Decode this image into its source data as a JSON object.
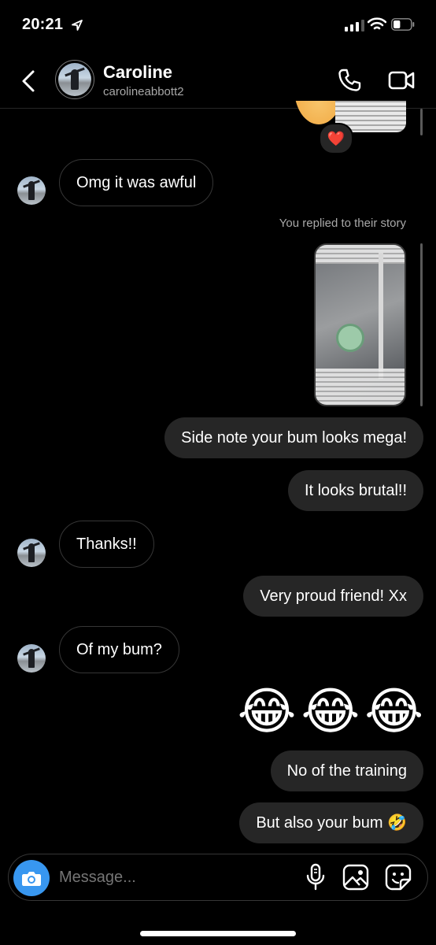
{
  "status_bar": {
    "time": "20:21",
    "battery_level": 0.4
  },
  "header": {
    "name": "Caroline",
    "handle": "carolineabbott2"
  },
  "messages": {
    "reaction_emoji": "❤️",
    "m1": "Omg it was awful",
    "replied_label": "You replied to their story",
    "m2": "Side note your bum looks mega!",
    "m3": "It looks brutal!!",
    "m4": "Thanks!!",
    "m5": "Very proud friend! Xx",
    "m6": "Of my bum?",
    "emoji_row": [
      "😂",
      "😂",
      "😂"
    ],
    "m7": "No of the training",
    "m8": "But also your bum 🤣"
  },
  "composer": {
    "placeholder": "Message..."
  },
  "colors": {
    "accent": "#3897f0",
    "incoming_border": "#363636",
    "outgoing_bg": "#262626",
    "secondary_text": "#a8a8a8"
  },
  "icons": [
    "location-arrow-icon",
    "signal-icon",
    "wifi-icon",
    "battery-icon",
    "back-chevron-icon",
    "phone-icon",
    "video-camera-icon",
    "camera-icon",
    "microphone-icon",
    "gallery-icon",
    "sticker-icon"
  ]
}
